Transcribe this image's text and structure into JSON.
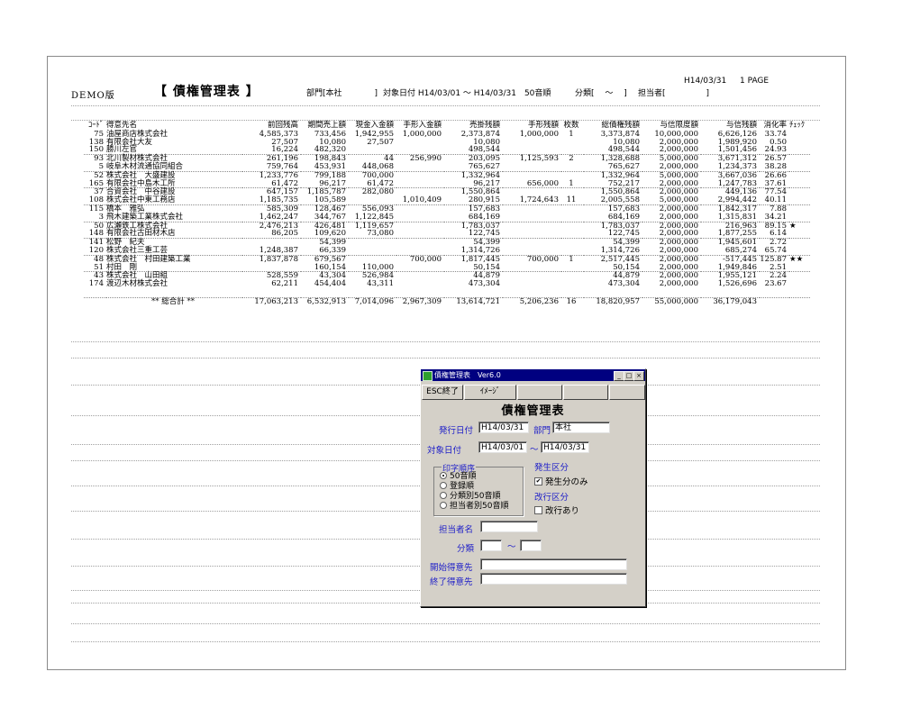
{
  "report": {
    "demo_label": "DEMO版",
    "title": "【 債権管理表 】",
    "date": "H14/03/31",
    "page": "1 PAGE",
    "dept": "部門[本社　　　　]",
    "target_date": "対象日付 H14/03/01 ～ H14/03/31　50音順",
    "category": "分類[　 ～　 ]",
    "rep": "担当者[　　　　　]",
    "columns": [
      "ｺｰﾄﾞ",
      "得意先名",
      "前回残高",
      "期間売上額",
      "現金入金額",
      "手形入金額",
      "売掛残額",
      "手形残額",
      "枚数",
      "総債権残額",
      "与信限度額",
      "与信残額",
      "消化率",
      "ﾁｪｯｸ"
    ],
    "rows": [
      [
        "75",
        "油屋商店株式会社",
        "4,585,373",
        "733,456",
        "1,942,955",
        "1,000,000",
        "2,373,874",
        "1,000,000",
        "1",
        "3,373,874",
        "10,000,000",
        "6,626,126",
        "33.74",
        ""
      ],
      [
        "138",
        "有限会社大友",
        "27,507",
        "10,080",
        "27,507",
        "",
        "10,080",
        "",
        "",
        "10,080",
        "2,000,000",
        "1,989,920",
        "0.50",
        ""
      ],
      [
        "150",
        "勝川左官",
        "16,224",
        "482,320",
        "",
        "",
        "498,544",
        "",
        "",
        "498,544",
        "2,000,000",
        "1,501,456",
        "24.93",
        ""
      ],
      [
        "93",
        "北川製材株式会社",
        "261,196",
        "198,843",
        "44",
        "256,990",
        "203,095",
        "1,125,593",
        "2",
        "1,328,688",
        "5,000,000",
        "3,671,312",
        "26.57",
        ""
      ],
      [
        "5",
        "岐阜木材流通協同組合",
        "759,764",
        "453,931",
        "448,068",
        "",
        "765,627",
        "",
        "",
        "765,627",
        "2,000,000",
        "1,234,373",
        "38.28",
        ""
      ],
      [
        "52",
        "株式会社　大盛建設",
        "1,233,776",
        "799,188",
        "700,000",
        "",
        "1,332,964",
        "",
        "",
        "1,332,964",
        "5,000,000",
        "3,667,036",
        "26.66",
        ""
      ],
      [
        "165",
        "有限会社中島木工所",
        "61,472",
        "96,217",
        "61,472",
        "",
        "96,217",
        "656,000",
        "1",
        "752,217",
        "2,000,000",
        "1,247,783",
        "37.61",
        ""
      ],
      [
        "37",
        "合資会社　中谷建設",
        "647,157",
        "1,185,787",
        "282,080",
        "",
        "1,550,864",
        "",
        "",
        "1,550,864",
        "2,000,000",
        "449,136",
        "77.54",
        ""
      ],
      [
        "108",
        "株式会社中東工務店",
        "1,185,735",
        "105,589",
        "",
        "1,010,409",
        "280,915",
        "1,724,643",
        "11",
        "2,005,558",
        "5,000,000",
        "2,994,442",
        "40.11",
        ""
      ],
      [
        "115",
        "橋本　雅弘",
        "585,309",
        "128,467",
        "556,093",
        "",
        "157,683",
        "",
        "",
        "157,683",
        "2,000,000",
        "1,842,317",
        "7.88",
        ""
      ],
      [
        "3",
        "飛木建築工業株式会社",
        "1,462,247",
        "344,767",
        "1,122,845",
        "",
        "684,169",
        "",
        "",
        "684,169",
        "2,000,000",
        "1,315,831",
        "34.21",
        ""
      ],
      [
        "50",
        "広瀬鉄工株式会社",
        "2,476,213",
        "426,481",
        "1,119,657",
        "",
        "1,783,037",
        "",
        "",
        "1,783,037",
        "2,000,000",
        "216,963",
        "89.15",
        "★"
      ],
      [
        "148",
        "有限会社古田材木店",
        "86,205",
        "109,620",
        "73,080",
        "",
        "122,745",
        "",
        "",
        "122,745",
        "2,000,000",
        "1,877,255",
        "6.14",
        ""
      ],
      [
        "141",
        "松野　紀夫",
        "",
        "54,399",
        "",
        "",
        "54,399",
        "",
        "",
        "54,399",
        "2,000,000",
        "1,945,601",
        "2.72",
        ""
      ],
      [
        "120",
        "株式会社三重工芸",
        "1,248,387",
        "66,339",
        "",
        "",
        "1,314,726",
        "",
        "",
        "1,314,726",
        "2,000,000",
        "685,274",
        "65.74",
        ""
      ],
      [
        "48",
        "株式会社　村田建築工業",
        "1,837,878",
        "679,567",
        "",
        "700,000",
        "1,817,445",
        "700,000",
        "1",
        "2,517,445",
        "2,000,000",
        "-517,445",
        "125.87",
        "★★"
      ],
      [
        "51",
        "村田　剛",
        "",
        "160,154",
        "110,000",
        "",
        "50,154",
        "",
        "",
        "50,154",
        "2,000,000",
        "1,949,846",
        "2.51",
        ""
      ],
      [
        "43",
        "株式会社　山田組",
        "528,559",
        "43,304",
        "526,984",
        "",
        "44,879",
        "",
        "",
        "44,879",
        "2,000,000",
        "1,955,121",
        "2.24",
        ""
      ],
      [
        "174",
        "渡辺木材株式会社",
        "62,211",
        "454,404",
        "43,311",
        "",
        "473,304",
        "",
        "",
        "473,304",
        "2,000,000",
        "1,526,696",
        "23.67",
        ""
      ]
    ],
    "total": [
      "** 総合計 **",
      "17,063,213",
      "6,532,913",
      "7,014,096",
      "2,967,309",
      "13,614,721",
      "5,206,236",
      "16",
      "18,820,957",
      "55,000,000",
      "36,179,043"
    ]
  },
  "dialog": {
    "window_title": "債権管理表　Ver6.0",
    "min_btn": "_",
    "max_btn": "□",
    "close_btn": "×",
    "esc_button": "ESC終了",
    "image_button": "ｲﾒｰｼﾞ",
    "heading": "債権管理表",
    "issue_date_label": "発行日付",
    "issue_date": "H14/03/31",
    "dept_label": "部門",
    "dept": "本社",
    "target_date_label": "対象日付",
    "target_from": "H14/03/01",
    "tilde": "～",
    "target_to": "H14/03/31",
    "print_order_label": "印字順序",
    "print_order_options": [
      "50音順",
      "登録順",
      "分類別50音順",
      "担当者別50音順"
    ],
    "print_order_selected": 0,
    "occurrence_label": "発生区分",
    "occurrence_check": "発生分のみ",
    "page_break_label": "改行区分",
    "page_break_check": "改行あり",
    "rep_label": "担当者名",
    "rep_value": "",
    "category_label": "分類",
    "category_from": "",
    "category_to": "",
    "start_customer_label": "開始得意先",
    "start_customer": "",
    "end_customer_label": "終了得意先",
    "end_customer": ""
  }
}
